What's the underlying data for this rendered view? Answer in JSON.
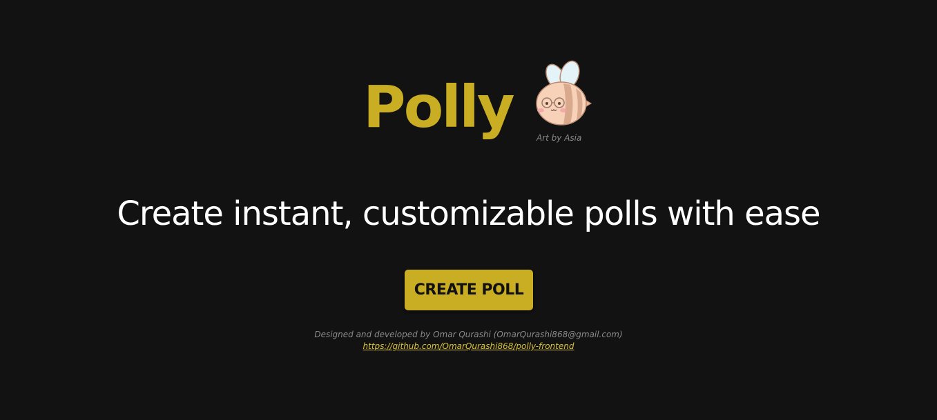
{
  "brand": {
    "title": "Polly",
    "mascot_icon": "bee-mascot-icon",
    "mascot_credit": "Art by Asia"
  },
  "hero": {
    "tagline": "Create instant, customizable polls with ease",
    "create_button_label": "CREATE POLL"
  },
  "footer": {
    "credit": "Designed and developed by Omar Qurashi (OmarQurashi868@gmail.com)",
    "repo_link": "https://github.com/OmarQurashi868/polly-frontend"
  },
  "colors": {
    "background": "#121212",
    "accent": "#c9ad22",
    "text": "#ffffff",
    "muted": "#8a8a8a",
    "link": "#d8c33a"
  }
}
